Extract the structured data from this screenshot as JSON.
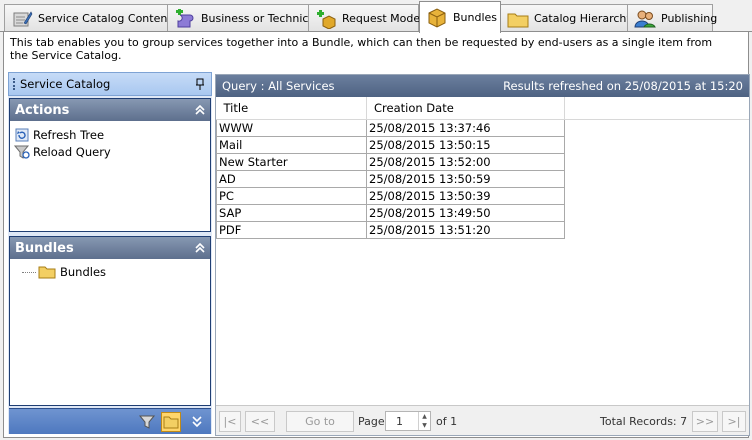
{
  "tabs": [
    {
      "label": "Service Catalog Contents",
      "icon": "notepad-pencil-icon"
    },
    {
      "label": "Business or Technical",
      "icon": "puzzle-add-icon"
    },
    {
      "label": "Request Mode",
      "icon": "box-add-icon"
    },
    {
      "label": "Bundles",
      "icon": "package-icon",
      "active": true
    },
    {
      "label": "Catalog Hierarchy",
      "icon": "folder-icon"
    },
    {
      "label": "Publishing",
      "icon": "users-icon"
    }
  ],
  "description": "This tab enables you to group services together into a Bundle, which can then be requested by end-users as a single item from the Service Catalog.",
  "left_panel": {
    "title": "Service Catalog",
    "actions": {
      "title": "Actions",
      "items": [
        {
          "label": "Refresh Tree",
          "icon": "refresh-icon"
        },
        {
          "label": "Reload Query",
          "icon": "funnel-reload-icon"
        }
      ]
    },
    "bundles": {
      "title": "Bundles",
      "tree_root": "Bundles"
    }
  },
  "query": {
    "label": "Query : All Services",
    "refreshed": "Results refreshed on 25/08/2015 at 15:20"
  },
  "grid": {
    "columns": [
      "Title",
      "Creation Date"
    ],
    "rows": [
      {
        "title": "WWW",
        "date": "25/08/2015 13:37:46"
      },
      {
        "title": "Mail",
        "date": "25/08/2015 13:50:15"
      },
      {
        "title": "New Starter",
        "date": "25/08/2015 13:52:00"
      },
      {
        "title": "AD",
        "date": "25/08/2015 13:50:59"
      },
      {
        "title": "PC",
        "date": "25/08/2015 13:50:39"
      },
      {
        "title": "SAP",
        "date": "25/08/2015 13:49:50"
      },
      {
        "title": "PDF",
        "date": "25/08/2015 13:51:20"
      }
    ]
  },
  "pager": {
    "first": "|<",
    "prev": "<<",
    "goto": "Go to",
    "page_label": "Page",
    "page_value": "1",
    "of_label": "of 1",
    "total": "Total Records: 7",
    "next": ">>",
    "last": ">|"
  },
  "colors": {
    "accent_blue": "#6f94d0",
    "header_slate": "#5d6f8d",
    "selected_button": "#ffd56b"
  }
}
